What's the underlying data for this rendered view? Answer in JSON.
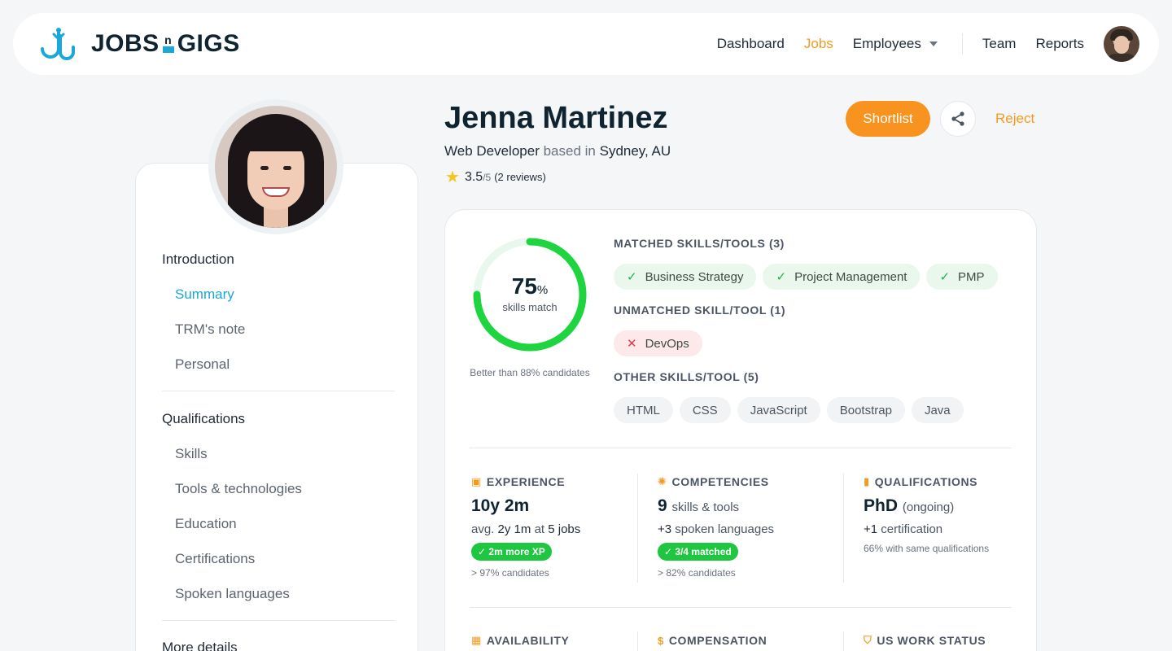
{
  "brand": {
    "logo_text_left": "JOBS",
    "logo_n": "n",
    "logo_text_right": "GIGS"
  },
  "nav": {
    "dashboard": "Dashboard",
    "jobs": "Jobs",
    "employees": "Employees",
    "team": "Team",
    "reports": "Reports",
    "active": "Jobs"
  },
  "sidebar": {
    "intro_head": "Introduction",
    "intro_items": [
      "Summary",
      "TRM's note",
      "Personal"
    ],
    "qual_head": "Qualifications",
    "qual_items": [
      "Skills",
      "Tools & technologies",
      "Education",
      "Certifications",
      "Spoken languages"
    ],
    "more_head": "More details"
  },
  "candidate": {
    "name": "Jenna Martinez",
    "role": "Web Developer",
    "based_in": "based in",
    "location": "Sydney, AU",
    "rating": "3.5",
    "rating_max": "/5",
    "reviews": "(2 reviews)"
  },
  "actions": {
    "shortlist": "Shortlist",
    "reject": "Reject"
  },
  "match": {
    "percent": "75",
    "percent_sign": "%",
    "label": "skills match",
    "value_fraction": 0.75,
    "note": "Better than 88% candidates"
  },
  "skills": {
    "matched_title": "MATCHED SKILLS/TOOLS (3)",
    "matched": [
      "Business Strategy",
      "Project Management",
      "PMP"
    ],
    "unmatched_title": "UNMATCHED SKILL/TOOL (1)",
    "unmatched": [
      "DevOps"
    ],
    "other_title": "OTHER SKILLS/TOOL (5)",
    "other": [
      "HTML",
      "CSS",
      "JavaScript",
      "Bootstrap",
      "Java"
    ]
  },
  "stats": {
    "experience": {
      "title": "EXPERIENCE",
      "value": "10y 2m",
      "avg_prefix": "avg.",
      "avg": "2y 1m",
      "at": "at",
      "jobs": "5 jobs",
      "pill": "2m more XP",
      "note": "> 97% candidates"
    },
    "competencies": {
      "title": "COMPETENCIES",
      "value": "9",
      "value_sub": "skills & tools",
      "extra_num": "+3",
      "extra_text": "spoken languages",
      "pill": "3/4 matched",
      "note": "> 82% candidates"
    },
    "qualifications": {
      "title": "QUALIFICATIONS",
      "value": "PhD",
      "value_sub": "(ongoing)",
      "extra_num": "+1",
      "extra_text": "certification",
      "note": "66% with same qualifications"
    },
    "availability": {
      "title": "AVAILABILITY"
    },
    "compensation": {
      "title": "COMPENSATION"
    },
    "work_status": {
      "title": "US WORK STATUS"
    }
  },
  "colors": {
    "accent": "#f7931e",
    "link": "#1aa7d9",
    "match": "#1ec73f",
    "unmatch": "#e33a4a"
  }
}
